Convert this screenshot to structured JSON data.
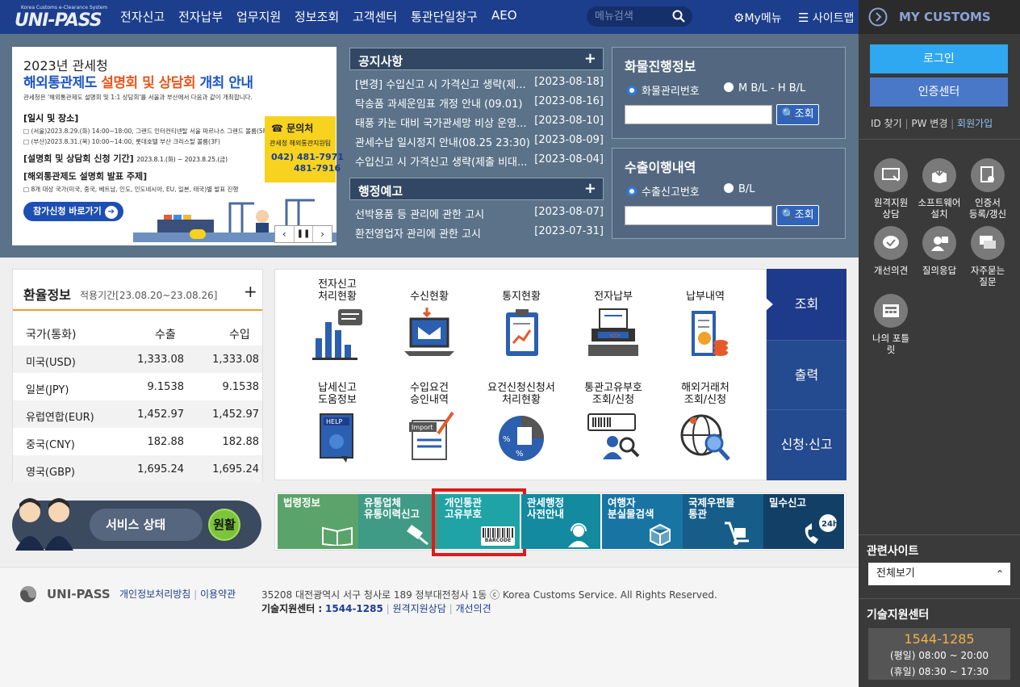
{
  "header": {
    "logo_small": "Korea Customs e-Clearance System",
    "logo": "UNI-PASS",
    "nav": [
      "전자신고",
      "전자납부",
      "업무지원",
      "정보조회",
      "고객센터",
      "통관단일창구",
      "AEO"
    ],
    "search_placeholder": "메뉴검색",
    "my_menu": "My메뉴",
    "sitemap": "사이트맵"
  },
  "banner": {
    "year_line": "2023년 관세청",
    "title_a": "해외통관제도 ",
    "title_b": "설명회 및 상담회",
    "title_c": " 개최 안내",
    "desc": "관세청은 '해외통관제도 설명회 및 1:1 상담회'를 서울과 부산에서 다음과 같이 개최합니다.",
    "sec1": "[일시 및 장소]",
    "sec1_l1": "□ (서울)2023.8.29.(화) 14:00~18:00, 그랜드 인터컨티넨탈 서울 파르나스 그랜드 볼룸(5F)",
    "sec1_l2": "□ (부산)2023.8.31.(목) 10:00~14:00, 롯데호텔 부산 크리스탈 볼룸(3F)",
    "sec2": "[설명회 및 상담회 신청 기간]",
    "sec2_v": "2023.8.1.(화) ~ 2023.8.25.(금)",
    "sec3": "[해외통관제도 설명회 발표 주제]",
    "sec3_l1": "□ 8개 대상 국가(미국, 중국, 베트남, 인도, 인도네시아, EU, 일본, 태국)별 발표 진행",
    "contact_title": "문의처",
    "contact_org": "관세청 해외통관지원팀",
    "contact_tel1": "042) 481-7971",
    "contact_tel2": "481-7916",
    "apply_btn": "참가신청 바로가기"
  },
  "notices": {
    "title": "공지사항",
    "items": [
      {
        "title": "[변경] 수입신고 시 가격신고 생략(제...",
        "date": "[2023-08-18]"
      },
      {
        "title": "탁송품 과세운임표 개정 안내 (09.01)",
        "date": "[2023-08-16]"
      },
      {
        "title": "태풍 카눈 대비 국가관세망 비상 운영...",
        "date": "[2023-08-10]"
      },
      {
        "title": "관세수납 일시정지 안내(08.25 23:30)",
        "date": "[2023-08-09]"
      },
      {
        "title": "수입신고 시 가격신고 생략(제출 비대...",
        "date": "[2023-08-04]"
      }
    ]
  },
  "admin_notices": {
    "title": "행정예고",
    "items": [
      {
        "title": "선박용품 등 관리에 관한 고시",
        "date": "[2023-08-07]"
      },
      {
        "title": "환전영업자 관리에 관한 고시",
        "date": "[2023-07-31]"
      }
    ]
  },
  "cargo": {
    "title": "화물진행정보",
    "opt1": "화물관리번호",
    "opt2": "M B/L - H B/L",
    "btn": "조회"
  },
  "export": {
    "title": "수출이행내역",
    "opt1": "수출신고번호",
    "opt2": "B/L",
    "btn": "조회"
  },
  "fx": {
    "title": "환율정보",
    "period": "적용기간[23.08.20~23.08.26]",
    "cols": [
      "국가(통화)",
      "수출",
      "수입"
    ],
    "rows": [
      [
        "미국(USD)",
        "1,333.08",
        "1,333.08"
      ],
      [
        "일본(JPY)",
        "9.1538",
        "9.1538"
      ],
      [
        "유럽연합(EUR)",
        "1,452.97",
        "1,452.97"
      ],
      [
        "중국(CNY)",
        "182.88",
        "182.88"
      ],
      [
        "영국(GBP)",
        "1,695.24",
        "1,695.24"
      ]
    ]
  },
  "services": {
    "row1": [
      "전자신고\n처리현황",
      "수신현황",
      "통지현황",
      "전자납부",
      "납부내역"
    ],
    "row2": [
      "납세신고\n도움정보",
      "수입요건\n승인내역",
      "요건신청신청서\n처리현황",
      "통관고유부호\n조회/신청",
      "해외거래처\n조회/신청"
    ],
    "tabs": [
      "조회",
      "출력",
      "신청·신고"
    ],
    "icon_texts": {
      "help": "HELP",
      "import": "Import",
      "barcode": "BARCODE",
      "h24": "24h"
    }
  },
  "status": {
    "label": "서비스 상태",
    "value": "원활"
  },
  "quick": [
    {
      "l1": "법령정보",
      "l2": "",
      "color": "#5aa36a"
    },
    {
      "l1": "유통업체",
      "l2": "유통이력신고",
      "color": "#3f9a86"
    },
    {
      "l1": "개인통관",
      "l2": "고유부호",
      "color": "#1fa3a6"
    },
    {
      "l1": "관세행정",
      "l2": "사전안내",
      "color": "#138aa0"
    },
    {
      "l1": "여행자",
      "l2": "분실물검색",
      "color": "#1874a3"
    },
    {
      "l1": "국제우편물",
      "l2": "통관",
      "color": "#165d8a"
    },
    {
      "l1": "밀수신고",
      "l2": "",
      "color": "#123f65"
    }
  ],
  "footer": {
    "brand": "UNI-PASS",
    "privacy": "개인정보처리방침",
    "terms": "이용약관",
    "address": "35208 대전광역시 서구 청사로 189 정부대전청사 1동 ⓒ Korea Customs Service. All Rights Reserved.",
    "tech_label": "기술지원센터 :",
    "tech_phone": "1544-1285",
    "remote": "원격지원상담",
    "improve": "개선의견"
  },
  "sidebar": {
    "title": "MY CUSTOMS",
    "login": "로그인",
    "cert": "인증센터",
    "id_find": "ID 찾기",
    "pw_change": "PW 변경",
    "join": "회원가입",
    "icons": [
      "원격지원\n상담",
      "소프트웨어\n설치",
      "인증서\n등록/갱신",
      "개선의견",
      "질의응답",
      "자주묻는\n질문",
      "나의 포틀\n릿"
    ],
    "related_title": "관련사이트",
    "related_select": "전체보기",
    "tech_title": "기술지원센터",
    "tech_phone": "1544-1285",
    "weekday": "(평일) 08:00 ~ 20:00",
    "holiday": "(휴일) 08:30 ~ 17:30"
  },
  "colors": {
    "header_bg": "#1c3e8c",
    "sidebar_bg": "#3a3a3a",
    "login_btn": "#2ea8f0",
    "cert_btn": "#4a78c9",
    "tab_active": "#1e3a8a",
    "tab_inactive": "#244a8f",
    "highlight": "#e01a1a",
    "fx_accent": "#f29b2a"
  }
}
